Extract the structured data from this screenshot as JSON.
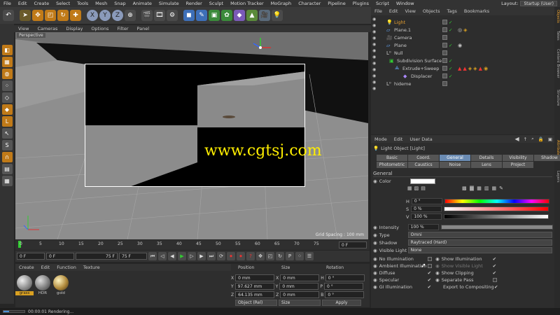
{
  "menu": {
    "items": [
      "File",
      "Edit",
      "Create",
      "Select",
      "Tools",
      "Mesh",
      "Snap",
      "Animate",
      "Simulate",
      "Render",
      "Sculpt",
      "Motion Tracker",
      "MoGraph",
      "Character",
      "Pipeline",
      "Plugins",
      "Script",
      "Window"
    ],
    "layout_label": "Layout:",
    "layout_value": "Startup (User)"
  },
  "viewport": {
    "menu": [
      "View",
      "Cameras",
      "Display",
      "Options",
      "Filter",
      "Panel"
    ],
    "label": "Perspective",
    "grid_spacing": "Grid Spacing : 100 mm",
    "watermark": "www.cgtsj.com"
  },
  "timeline": {
    "ticks": [
      "0",
      "5",
      "10",
      "15",
      "20",
      "25",
      "30",
      "35",
      "40",
      "45",
      "50",
      "55",
      "60",
      "65",
      "70",
      "75"
    ],
    "end_field": "0 F",
    "start": "0 F",
    "range_start": "0 F",
    "range_end": "75 F",
    "end": "75 F"
  },
  "materials": {
    "menu": [
      "Create",
      "Edit",
      "Function",
      "Texture"
    ],
    "items": [
      {
        "name": "grass",
        "color": "#d9a021"
      },
      {
        "name": "HDR",
        "color": "#9a9a9a"
      },
      {
        "name": "gold",
        "color": "#b08a3c"
      }
    ]
  },
  "coords": {
    "headers": [
      "Position",
      "Size",
      "Rotation"
    ],
    "rows": [
      {
        "axis": "X",
        "pos": "0 mm",
        "size_axis": "X",
        "size": "0 mm",
        "rot_axis": "H",
        "rot": "0 °"
      },
      {
        "axis": "Y",
        "pos": "97.627 mm",
        "size_axis": "Y",
        "size": "0 mm",
        "rot_axis": "P",
        "rot": "0 °"
      },
      {
        "axis": "Z",
        "pos": "64.135 mm",
        "size_axis": "Z",
        "size": "0 mm",
        "rot_axis": "B",
        "rot": "0 °"
      }
    ],
    "mode": "Object (Rel)",
    "size_mode": "Size",
    "apply": "Apply"
  },
  "status": {
    "time": "00:00:01 Rendering..."
  },
  "object_manager": {
    "menu": [
      "File",
      "Edit",
      "View",
      "Objects",
      "Tags",
      "Bookmarks"
    ],
    "objects": [
      {
        "name": "Light",
        "indent": 0,
        "selected": true
      },
      {
        "name": "Plane.1",
        "indent": 0,
        "selected": false
      },
      {
        "name": "Camera",
        "indent": 0,
        "selected": false
      },
      {
        "name": "Plane",
        "indent": 0,
        "selected": false
      },
      {
        "name": "Null",
        "indent": 0,
        "selected": false
      },
      {
        "name": "Subdivision Surface",
        "indent": 1,
        "selected": false
      },
      {
        "name": "Extrude+Sweep",
        "indent": 2,
        "selected": false
      },
      {
        "name": "Displacer",
        "indent": 3,
        "selected": false
      },
      {
        "name": "hideme",
        "indent": 0,
        "selected": false
      }
    ]
  },
  "side_strip": [
    "Objects",
    "Takes",
    "Content Browser",
    "Structure",
    "Attributes",
    "Layers"
  ],
  "attributes": {
    "menu": [
      "Mode",
      "Edit",
      "User Data"
    ],
    "object_title": "Light Object [Light]",
    "tabs_row1": [
      "Basic",
      "Coord.",
      "General",
      "Details",
      "Visibility",
      "Shadow"
    ],
    "tabs_row2": [
      "Photometric",
      "Caustics",
      "Noise",
      "Lens",
      "Project"
    ],
    "active_tab": "General",
    "section": "General",
    "color_label": "Color",
    "h_label": "H",
    "h_value": "0 °",
    "s_label": "S",
    "s_value": "0 %",
    "v_label": "V",
    "v_value": "100 %",
    "intensity_label": "Intensity",
    "intensity_value": "100 %",
    "type_label": "Type",
    "type_value": "Omni",
    "shadow_label": "Shadow",
    "shadow_value": "Raytraced (Hard)",
    "visible_light_label": "Visible Light",
    "visible_light_value": "None",
    "checks_left": [
      {
        "label": "No Illumination",
        "checked": false
      },
      {
        "label": "Ambient Illumination",
        "checked": false
      },
      {
        "label": "Diffuse",
        "checked": true
      },
      {
        "label": "Specular",
        "checked": true
      },
      {
        "label": "GI Illumination",
        "checked": true
      }
    ],
    "checks_right": [
      {
        "label": "Show Illumination",
        "checked": true,
        "dim": false
      },
      {
        "label": "Show Visible Light",
        "checked": true,
        "dim": true
      },
      {
        "label": "Show Clipping",
        "checked": true,
        "dim": false
      },
      {
        "label": "Separate Pass",
        "checked": false,
        "dim": false
      },
      {
        "label": "Export to Compositing",
        "checked": true,
        "dim": false
      }
    ]
  }
}
